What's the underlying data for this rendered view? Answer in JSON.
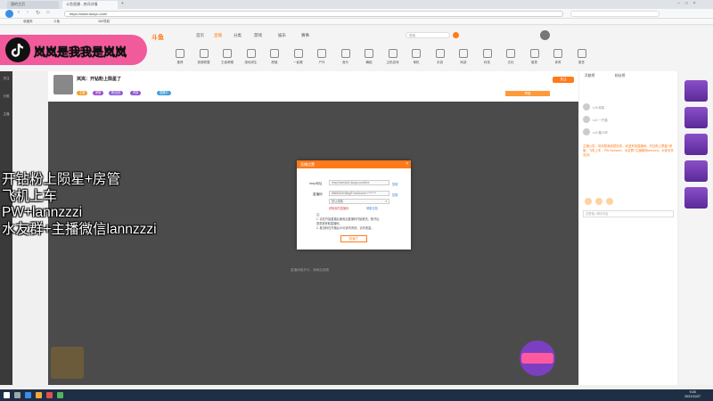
{
  "browser": {
    "tabs": [
      {
        "label": "我的主页",
        "active": false
      },
      {
        "label": "斗鱼直播 - 房间详情",
        "active": true
      }
    ],
    "url": "https://www.douyu.com/",
    "bookmarks": [
      "收藏夹",
      "斗鱼",
      "360导航"
    ]
  },
  "site": {
    "logo": "斗鱼",
    "nav": [
      "首页",
      "直播",
      "分类",
      "游戏",
      "娱乐",
      "赛事"
    ],
    "nav_active_index": 1,
    "search_placeholder": "搜索",
    "categories": [
      "推荐",
      "英雄联盟",
      "王者荣耀",
      "绝地求生",
      "颜值",
      "一起看",
      "户外",
      "音乐",
      "舞蹈",
      "主机游戏",
      "单机",
      "手游",
      "网游",
      "科技",
      "文化",
      "星秀",
      "体育",
      "更多"
    ]
  },
  "room": {
    "title": "岚岚：开钻粉上陨星了",
    "pills": [
      {
        "label": "主播",
        "color": "#f0a030"
      },
      {
        "label": "房管",
        "color": "#a050d0"
      },
      {
        "label": "粉丝团",
        "color": "#9060e0"
      },
      {
        "label": "贵族",
        "color": "#8f55d8"
      },
      {
        "label": "直播中",
        "color": "#40a0e0"
      }
    ],
    "follow_label": "关注",
    "report_label": "举报"
  },
  "dialog": {
    "title": "直播设置",
    "close": "×",
    "rtmp_label": "rtmp地址",
    "rtmp_value": "rtmp://sendtc3.douyu.com/live",
    "rtmp_copy": "复制",
    "code_label": "直播码",
    "code_value": "8868520rN6bgR?wsSecret=********",
    "code_copy": "复制",
    "select_value": "默认线路",
    "link_left": "获取新的直播码",
    "link_right": "帮助文档",
    "notes": [
      "注：",
      "1. 请在开始直播后使用此直播码开始推流，断开后",
      "需重新获取直播码。",
      "2. 推流码在开播后20分钟内有效，请勿泄露。"
    ],
    "confirm_label": "知道了"
  },
  "video": {
    "hint": "直播间维护中，请稍后观看"
  },
  "chat": {
    "tabs": [
      "贡献榜",
      "粉丝榜"
    ],
    "users": [
      "Lv3 岚岚",
      "Lv2 一只猫",
      "Lv1 路人甲"
    ],
    "notice": "主播公告：岚岚是我我是岚岚，欢迎来到直播间。开钻粉上陨星+房管，飞机上车，PW+lannzzzi，水友群+主播微信lannzzzi。大家多多支持！",
    "input_placeholder": "这里输入聊天内容"
  },
  "overlay": {
    "banner_title": "岚岚是我我是岚岚",
    "lines": [
      "开钻粉上陨星+房管",
      "飞机上车",
      "PW+lannzzzi",
      "水友群+主播微信lannzzzi"
    ]
  },
  "left_bar": [
    "关注",
    "分类",
    "主播"
  ],
  "taskbar": {
    "time": "9:28",
    "date": "2021/11/27"
  },
  "colors": {
    "accent": "#ff7a1a",
    "overlay_pink": "#f15b9c",
    "taskbar": "#1e2f45"
  }
}
